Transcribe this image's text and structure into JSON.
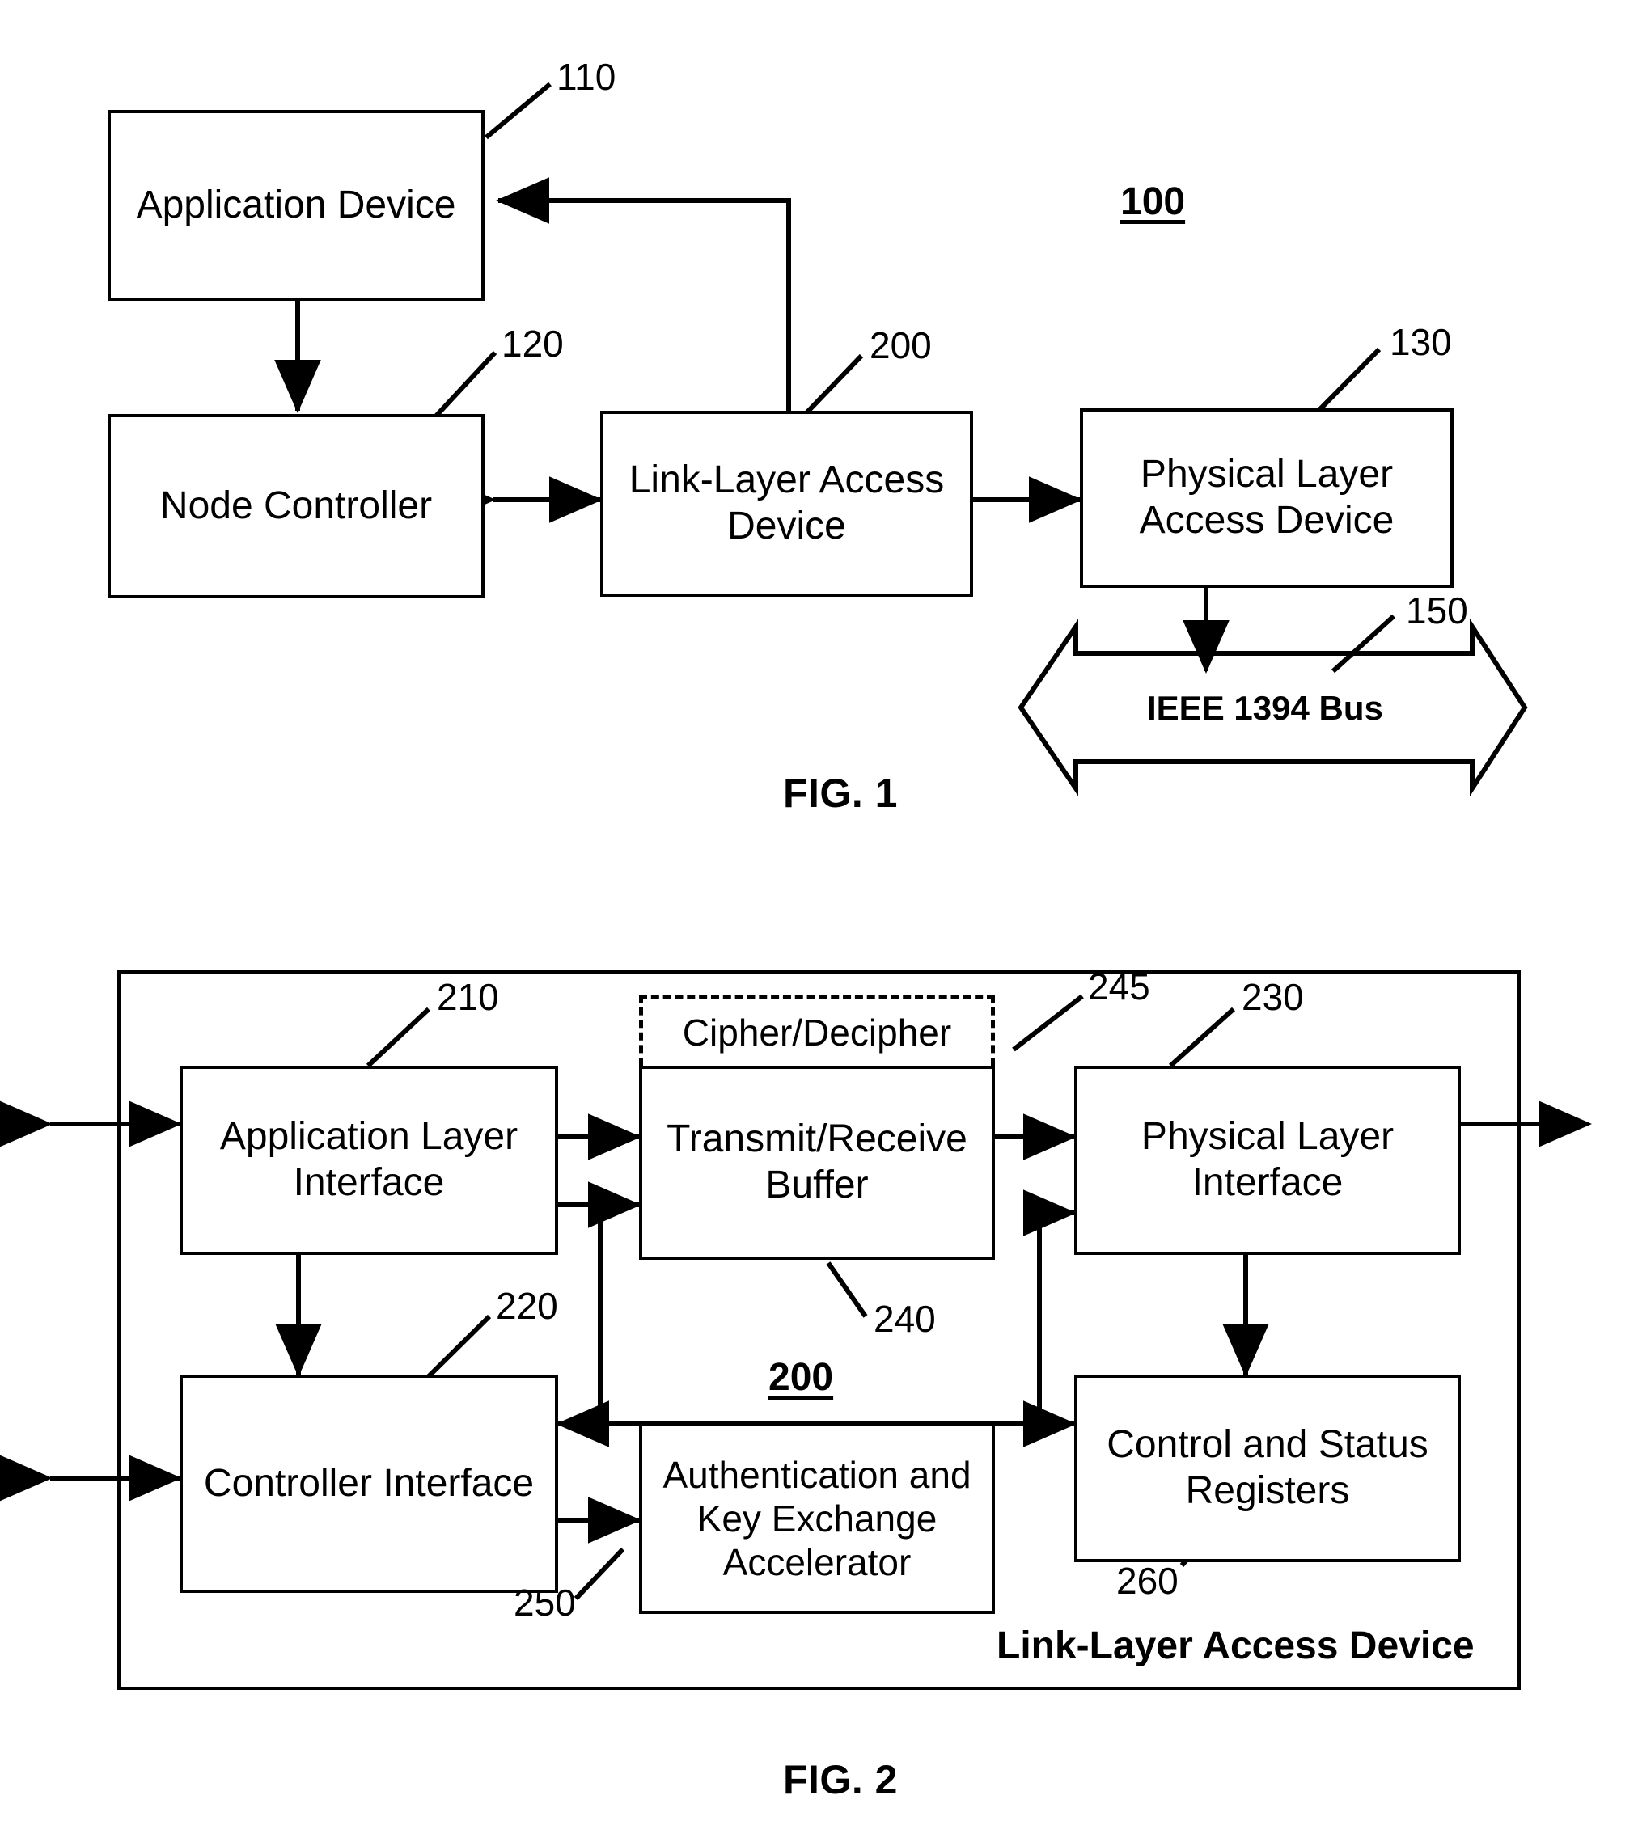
{
  "figure1": {
    "caption": "FIG. 1",
    "system_ref": "100",
    "boxes": [
      {
        "id": "application-device",
        "label": "Application Device",
        "ref": "110"
      },
      {
        "id": "node-controller",
        "label": "Node Controller",
        "ref": "120"
      },
      {
        "id": "link-layer-access-device",
        "label_line1": "Link-Layer Access",
        "label_line2": "Device",
        "ref": "200"
      },
      {
        "id": "physical-layer-access-device",
        "label_line1": "Physical Layer",
        "label_line2": "Access Device",
        "ref": "130"
      }
    ],
    "bus": {
      "label": "IEEE 1394 Bus",
      "ref": "150"
    }
  },
  "figure2": {
    "caption": "FIG. 2",
    "system_ref": "200",
    "container_label": "Link-Layer Access Device",
    "boxes": [
      {
        "id": "application-layer-interface",
        "label_line1": "Application Layer",
        "label_line2": "Interface",
        "ref": "210"
      },
      {
        "id": "transmit-receive-buffer",
        "label_line1": "Transmit/Receive",
        "label_line2": "Buffer",
        "ref": "240"
      },
      {
        "id": "physical-layer-interface",
        "label_line1": "Physical Layer",
        "label_line2": "Interface",
        "ref": "230"
      },
      {
        "id": "controller-interface",
        "label_line1": "Controller Interface",
        "label_line2": "",
        "ref": "220"
      },
      {
        "id": "authentication-key-exchange-accelerator",
        "label_line1": "Authentication and",
        "label_line2": "Key Exchange",
        "label_line3": "Accelerator",
        "ref": "250"
      },
      {
        "id": "control-and-status-registers",
        "label_line1": "Control and Status",
        "label_line2": "Registers",
        "ref": "260"
      }
    ],
    "cipher": {
      "label": "Cipher/Decipher",
      "ref": "245"
    }
  },
  "colors": {
    "ink": "#000000",
    "paper": "#ffffff"
  }
}
